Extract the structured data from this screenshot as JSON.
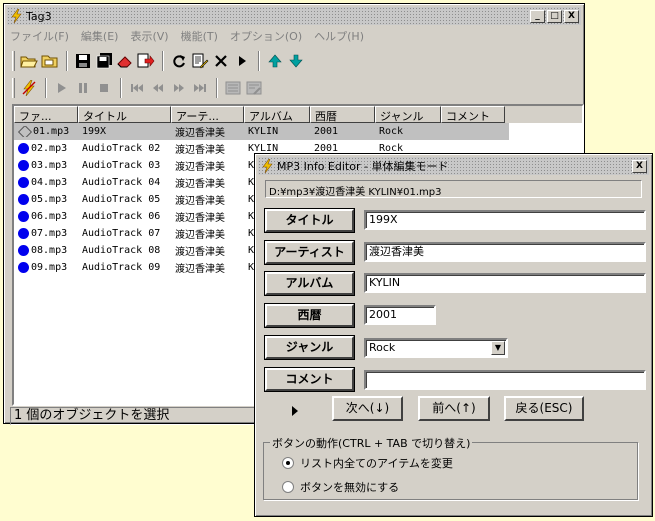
{
  "main_window": {
    "title": "Tag3",
    "controls": {
      "minimize": "_",
      "maximize": "□",
      "close": "X"
    },
    "menu": [
      "ファイル(F)",
      "編集(E)",
      "表示(V)",
      "機能(T)",
      "オプション(O)",
      "ヘルプ(H)"
    ],
    "columns": [
      "ファ...",
      "タイトル",
      "アーテ...",
      "アルバム",
      "西暦",
      "ジャンル",
      "コメント"
    ],
    "rows": [
      {
        "file": "01.mp3",
        "title": "199X",
        "artist": "渡辺香津美",
        "album": "KYLIN",
        "year": "2001",
        "genre": "Rock",
        "comment": ""
      },
      {
        "file": "02.mp3",
        "title": "AudioTrack 02",
        "artist": "渡辺香津美",
        "album": "KYLIN",
        "year": "2001",
        "genre": "Rock",
        "comment": ""
      },
      {
        "file": "03.mp3",
        "title": "AudioTrack 03",
        "artist": "渡辺香津美",
        "album": "K",
        "year": "",
        "genre": "",
        "comment": ""
      },
      {
        "file": "04.mp3",
        "title": "AudioTrack 04",
        "artist": "渡辺香津美",
        "album": "K",
        "year": "",
        "genre": "",
        "comment": ""
      },
      {
        "file": "05.mp3",
        "title": "AudioTrack 05",
        "artist": "渡辺香津美",
        "album": "K",
        "year": "",
        "genre": "",
        "comment": ""
      },
      {
        "file": "06.mp3",
        "title": "AudioTrack 06",
        "artist": "渡辺香津美",
        "album": "K",
        "year": "",
        "genre": "",
        "comment": ""
      },
      {
        "file": "07.mp3",
        "title": "AudioTrack 07",
        "artist": "渡辺香津美",
        "album": "K",
        "year": "",
        "genre": "",
        "comment": ""
      },
      {
        "file": "08.mp3",
        "title": "AudioTrack 08",
        "artist": "渡辺香津美",
        "album": "K",
        "year": "",
        "genre": "",
        "comment": ""
      },
      {
        "file": "09.mp3",
        "title": "AudioTrack 09",
        "artist": "渡辺香津美",
        "album": "K",
        "year": "",
        "genre": "",
        "comment": ""
      }
    ],
    "status": "1 個のオブジェクトを選択"
  },
  "dialog": {
    "title": "MP3 Info Editor - 単体編集モード",
    "close": "X",
    "path": "D:¥mp3¥渡辺香津美 KYLIN¥01.mp3",
    "fields": {
      "title_label": "タイトル",
      "title_value": "199X",
      "artist_label": "アーティスト",
      "artist_value": "渡辺香津美",
      "album_label": "アルバム",
      "album_value": "KYLIN",
      "year_label": "西暦",
      "year_value": "2001",
      "genre_label": "ジャンル",
      "genre_value": "Rock",
      "comment_label": "コメント",
      "comment_value": ""
    },
    "nav": {
      "next": "次へ(↓)",
      "prev": "前へ(↑)",
      "back": "戻る(ESC)"
    },
    "group": {
      "label": "ボタンの動作(CTRL + TAB で切り替え)",
      "option1": "リスト内全てのアイテムを変更",
      "option2": "ボタンを無効にする",
      "selected": "option1"
    }
  },
  "icons": [
    "lightning-icon",
    "open-folder-icon",
    "folder-icon",
    "save-icon",
    "save-all-icon",
    "eraser-icon",
    "export-icon",
    "refresh-icon",
    "edit-doc-icon",
    "delete-icon",
    "play-arrow-icon",
    "up-arrow-icon",
    "down-arrow-icon"
  ],
  "colors": {
    "desktop": "#fffdd0",
    "face": "#d4d0c8",
    "selection": "#c0c0c0",
    "bullet": "#0000ee",
    "accent_arrow": "#00a0a0"
  }
}
